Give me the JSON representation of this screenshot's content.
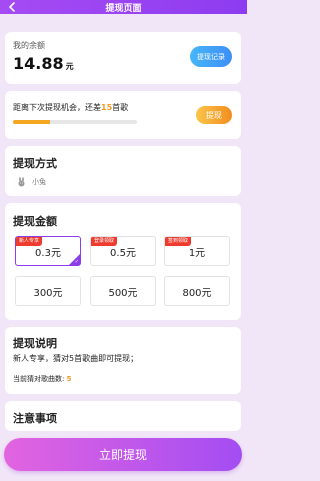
{
  "header": {
    "title": "提现页面"
  },
  "balance": {
    "label": "我的余额",
    "amount": "14.88",
    "unit": "元",
    "record_button": "提现记录"
  },
  "chance": {
    "text_prefix": "距离下次提现机会，还差",
    "remaining": "15",
    "text_suffix": "首歌",
    "progress_fraction": 0.3,
    "button": "提现"
  },
  "method": {
    "title": "提现方式",
    "option": "小兔"
  },
  "amount": {
    "title": "提现金额",
    "options": [
      {
        "label": "0.3元",
        "tag": "新人专享",
        "selected": true
      },
      {
        "label": "0.5元",
        "tag": "登录领取",
        "selected": false
      },
      {
        "label": "1元",
        "tag": "签到领取",
        "selected": false
      },
      {
        "label": "300元",
        "tag": "",
        "selected": false
      },
      {
        "label": "500元",
        "tag": "",
        "selected": false
      },
      {
        "label": "800元",
        "tag": "",
        "selected": false
      }
    ]
  },
  "explanation": {
    "title": "提现说明",
    "line1": "新人专享，猜对5首歌曲即可提现；",
    "line2_prefix": "当前猜对歌曲数:",
    "line2_value": "5"
  },
  "notes": {
    "title": "注意事项"
  },
  "submit": {
    "label": "立即提现"
  },
  "colors": {
    "accent": "#8a3de8",
    "orange": "#f29b23",
    "tag_red": "#ee3b2e"
  }
}
